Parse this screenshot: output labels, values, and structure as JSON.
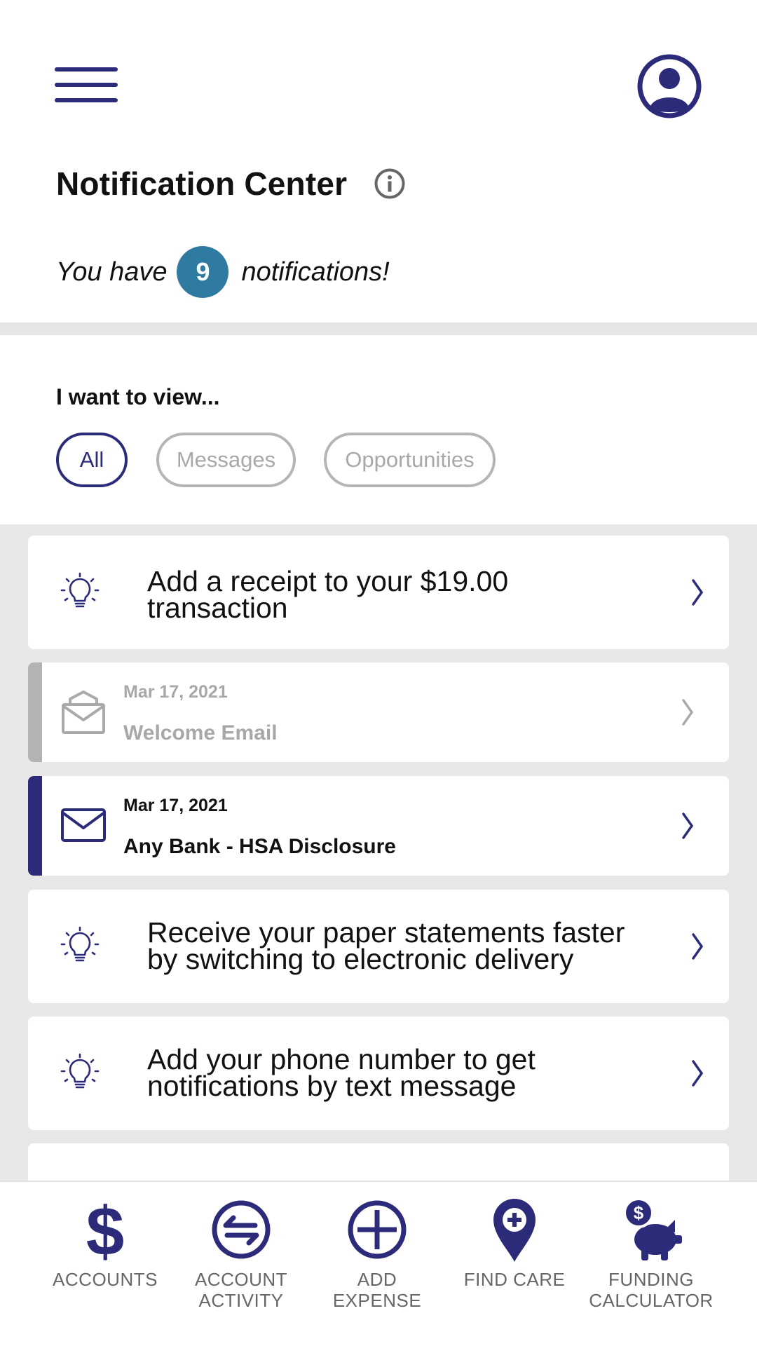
{
  "header": {
    "title": "Notification Center",
    "count_prefix": "You have",
    "count": "9",
    "count_suffix": "notifications!"
  },
  "filter": {
    "label": "I want to view...",
    "options": [
      "All",
      "Messages",
      "Opportunities"
    ],
    "selected": "All"
  },
  "notifications": [
    {
      "type": "opportunity",
      "line1": "Add a receipt to your $19.00",
      "line2": "transaction"
    },
    {
      "type": "message",
      "read": true,
      "date": "Mar 17, 2021",
      "title": "Welcome Email"
    },
    {
      "type": "message",
      "read": false,
      "date": "Mar 17, 2021",
      "title": "Any Bank - HSA Disclosure"
    },
    {
      "type": "opportunity",
      "line1": "Receive your paper statements faster",
      "line2": "by switching to electronic delivery"
    },
    {
      "type": "opportunity",
      "line1": "Add your phone number to get",
      "line2": "notifications by text message"
    }
  ],
  "tabbar": {
    "items": [
      {
        "line1": "ACCOUNTS",
        "line2": "",
        "icon": "dollar-icon"
      },
      {
        "line1": "ACCOUNT",
        "line2": "ACTIVITY",
        "icon": "exchange-arrows-icon"
      },
      {
        "line1": "ADD",
        "line2": "EXPENSE",
        "icon": "plus-circle-icon"
      },
      {
        "line1": "FIND CARE",
        "line2": "",
        "icon": "map-pin-plus-icon"
      },
      {
        "line1": "FUNDING",
        "line2": "CALCULATOR",
        "icon": "piggy-bank-icon"
      }
    ]
  },
  "colors": {
    "brand": "#2c2b7a",
    "badge": "#2e7aa1",
    "read_accent": "#b3b3b3",
    "muted_text": "#a8a8a8",
    "list_background": "#e8e8e8"
  }
}
